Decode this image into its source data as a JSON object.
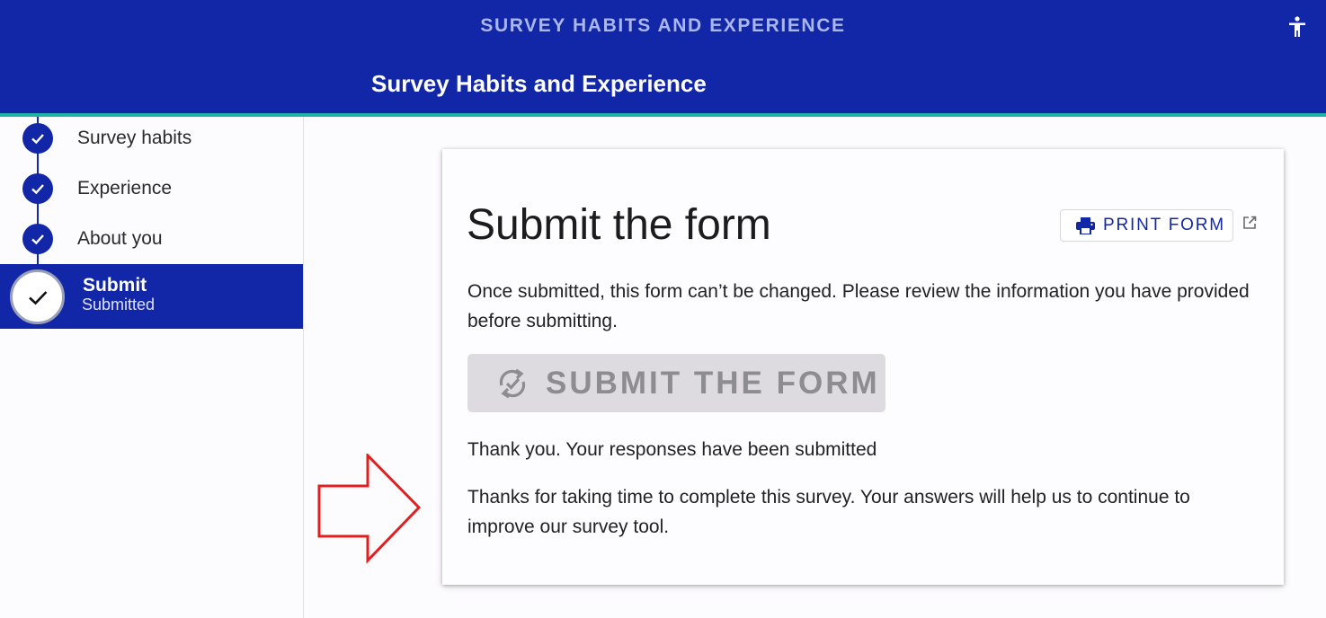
{
  "header": {
    "app_title": "SURVEY HABITS AND EXPERIENCE",
    "page_heading": "Survey Habits and Experience",
    "accessibility_icon": "accessibility-icon"
  },
  "sidebar": {
    "steps": [
      {
        "label": "Survey habits",
        "icon": "check-icon",
        "status": "complete"
      },
      {
        "label": "Experience",
        "icon": "check-icon",
        "status": "complete"
      },
      {
        "label": "About you",
        "icon": "check-icon",
        "status": "complete"
      }
    ],
    "active_step": {
      "label": "Submit",
      "sublabel": "Submitted",
      "icon": "check-icon"
    }
  },
  "card": {
    "title": "Submit the form",
    "print_button": {
      "label": "PRINT FORM",
      "icon": "printer-icon"
    },
    "external_icon": "external-link-icon",
    "warning_text": "Once submitted, this form can’t be changed. Please review the information you have provided before submitting.",
    "submit_button": {
      "label": "SUBMIT THE FORM",
      "icon": "sync-check-icon",
      "disabled": true
    },
    "thank_you": "Thank you. Your responses have been submitted",
    "thanks_detail": "Thanks for taking time to complete this survey. Your answers will help us to continue to improve our survey tool."
  },
  "annotation": {
    "icon": "red-arrow-icon",
    "color": "#e02020"
  },
  "colors": {
    "brand": "#1226a8",
    "accent": "#1fb3a8"
  }
}
